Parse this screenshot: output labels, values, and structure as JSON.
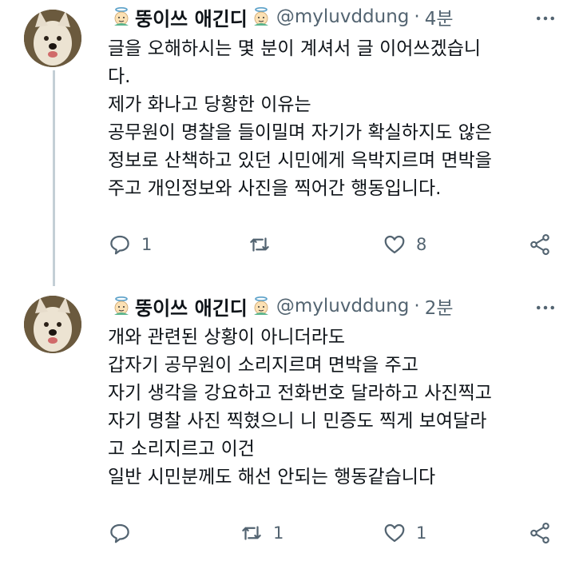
{
  "tweets": [
    {
      "display_name": "뚱이쓰 애긴디",
      "handle": "@myluvddung",
      "separator": "·",
      "time": "4분",
      "lines": [
        "글을 오해하시는 몇 분이 계셔서 글 이어쓰겠습니",
        "다.",
        "제가 화나고 당황한 이유는",
        "공무원이 명찰을 들이밀며 자기가 확실하지도 않은",
        "정보로 산책하고 있던 시민에게 윽박지르며 면박을",
        "주고 개인정보와 사진을 찍어간 행동입니다."
      ],
      "reply_count": "1",
      "retweet_count": "",
      "like_count": "8"
    },
    {
      "display_name": "뚱이쓰 애긴디",
      "handle": "@myluvddung",
      "separator": "·",
      "time": "2분",
      "lines": [
        "개와 관련된 상황이 아니더라도",
        "갑자기 공무원이 소리지르며 면박을 주고",
        "자기 생각을 강요하고 전화번호 달라하고 사진찍고",
        "자기 명찰 사진 찍혔으니 니 민증도 찍게 보여달라",
        "고 소리지르고 이건",
        "일반 시민분께도 해선 안되는 행동같습니다"
      ],
      "reply_count": "",
      "retweet_count": "1",
      "like_count": "1"
    }
  ],
  "icons": {
    "reply": "speech-bubble-icon",
    "retweet": "retweet-arrows-icon",
    "like": "heart-icon",
    "share": "share-icon",
    "more": "more-dots-icon",
    "name_emoji": "angel-face-emoji-icon"
  },
  "colors": {
    "text": "#0f1419",
    "secondary": "#536471",
    "thread_line": "#c4cfd6"
  }
}
